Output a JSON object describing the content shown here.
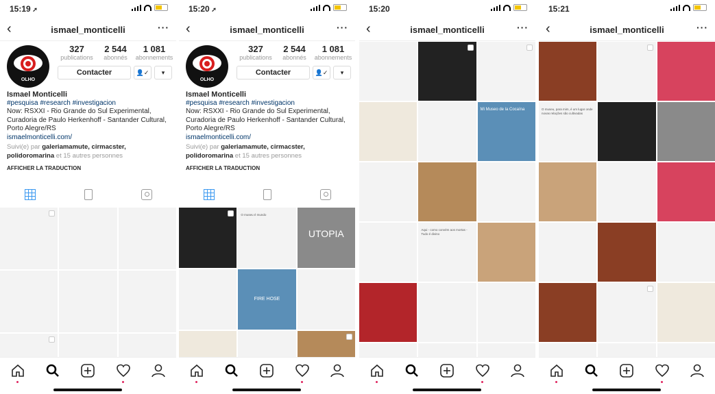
{
  "screens": [
    {
      "time": "15:19",
      "has_arrow": true,
      "variant": "profile"
    },
    {
      "time": "15:20",
      "has_arrow": true,
      "variant": "profile-scrolled"
    },
    {
      "time": "15:20",
      "has_arrow": false,
      "variant": "grid"
    },
    {
      "time": "15:21",
      "has_arrow": false,
      "variant": "grid"
    }
  ],
  "username": "ismael_monticelli",
  "stats": [
    {
      "count": "327",
      "label": "publications"
    },
    {
      "count": "2 544",
      "label": "abonnés"
    },
    {
      "count": "1 081",
      "label": "abonnements"
    }
  ],
  "contact_label": "Contacter",
  "avatar_text": "OLHO",
  "bio": {
    "name": "Ismael Monticelli",
    "tags": "#pesquisa #research #investigacion",
    "line1": "Now: RSXXI - Rio Grande do Sul Experimental,",
    "line2": "Curadoria de Paulo Herkenhoff - Santander Cultural,",
    "line3": "Porto Alegre/RS",
    "link": "ismaelmonticelli.com/",
    "followed_prefix": "Suivi(e) par",
    "followers": "galeriamamute, cirmacster, polidoromarina",
    "followed_suffix": "et 15 autres personnes",
    "translate": "AFFICHER LA TRADUCTION"
  },
  "posts_text": {
    "p_museu": "O museu é mundo",
    "p_utopia": "UTOPIA",
    "p_fire": "FIRE HOSE",
    "p_museu_doce": "Mi Museo de la Cocaína",
    "p_mortas": "Aqui - como convém aos mortas - Tudo é divino",
    "p_museu_text": "O museu, para mim, é um lugar onde novas relações são cultivadas"
  }
}
